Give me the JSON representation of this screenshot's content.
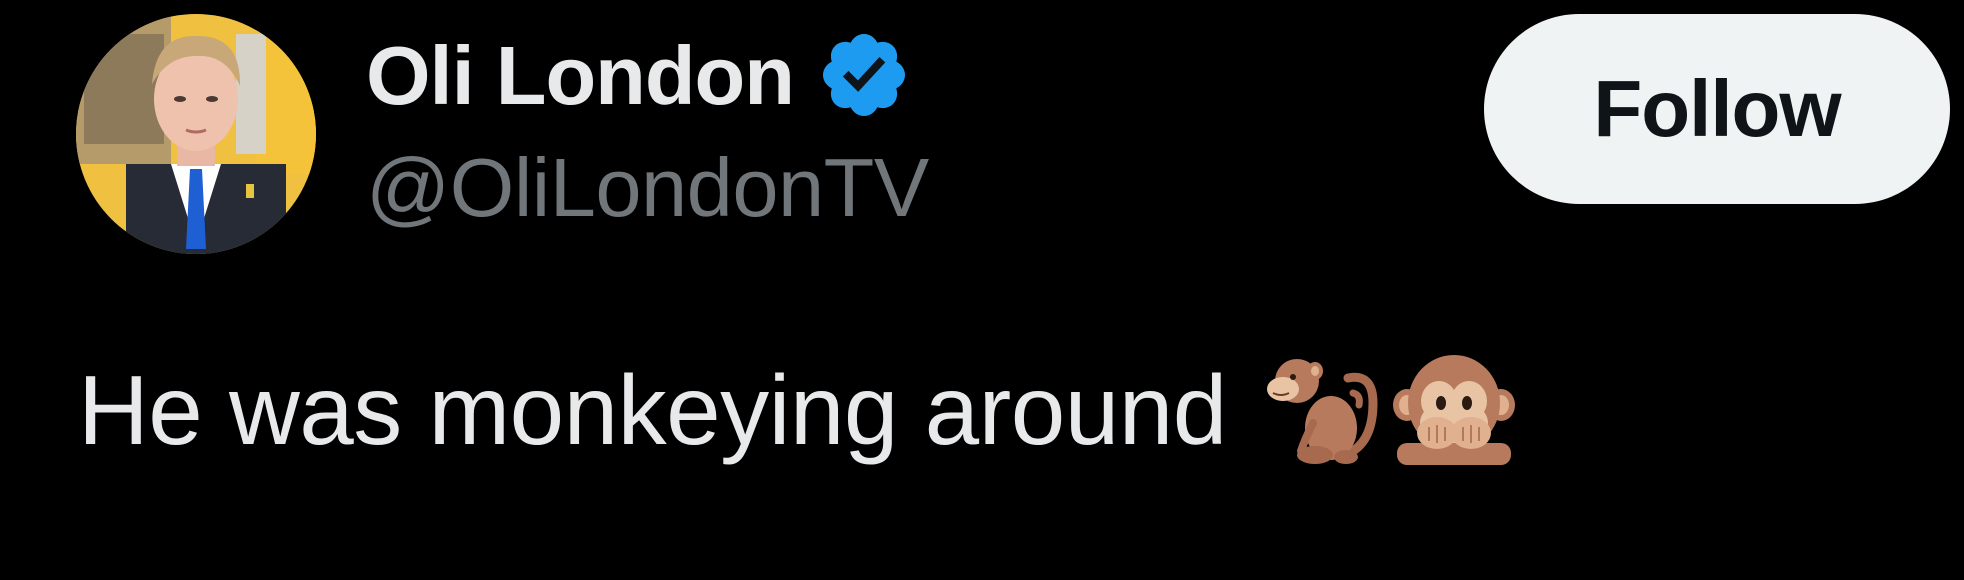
{
  "user": {
    "display_name": "Oli London",
    "handle": "@OliLondonTV",
    "verified": true
  },
  "follow_button": {
    "label": "Follow"
  },
  "tweet": {
    "text": "He was monkeying around",
    "emojis": [
      "monkey-emoji",
      "speak-no-evil-monkey-emoji"
    ]
  },
  "colors": {
    "background": "#000000",
    "primary_text": "#e7e9ea",
    "secondary_text": "#71767b",
    "verified_badge": "#1d9bf0",
    "follow_button_bg": "#eff3f4",
    "follow_button_text": "#0f1419"
  }
}
